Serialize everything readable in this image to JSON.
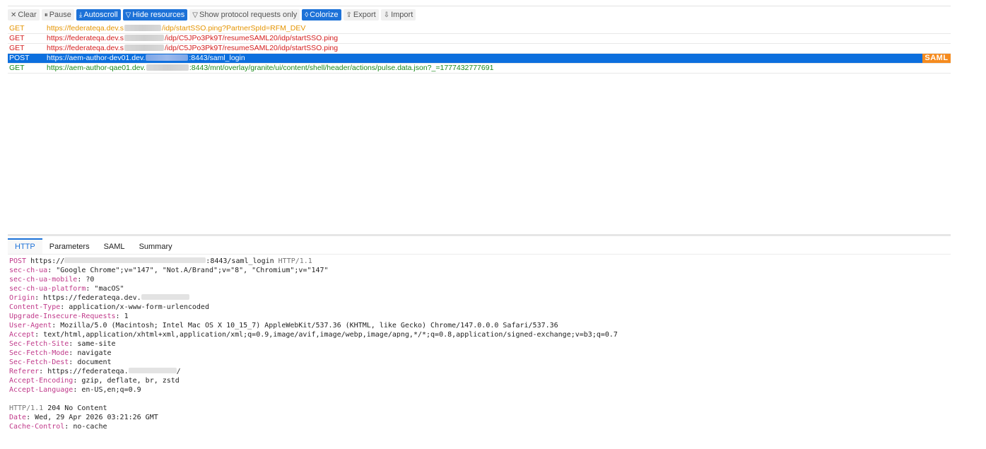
{
  "toolbar": {
    "clear": {
      "icon": "✕",
      "label": "Clear"
    },
    "pause": {
      "icon": "⏸",
      "label": "Pause"
    },
    "autoscroll": {
      "icon": "⤓",
      "label": "Autoscroll"
    },
    "hide_resources": {
      "icon": "▽",
      "label": "Hide resources"
    },
    "protocol_only": {
      "icon": "▽",
      "label": "Show protocol requests only"
    },
    "colorize": {
      "icon": "◊",
      "label": "Colorize"
    },
    "export": {
      "icon": "⇪",
      "label": "Export"
    },
    "import": {
      "icon": "⇩",
      "label": "Import"
    }
  },
  "requests": [
    {
      "method": "GET",
      "url_a": "https://federateqa.dev.s",
      "url_b": "/idp/startSSO.ping?PartnerSpId=RFM_DEV",
      "color": "#e59400"
    },
    {
      "method": "GET",
      "url_a": "https://federateqa.dev.s",
      "url_b": "/idp/C5JPo3Pk9T/resumeSAML20/idp/startSSO.ping",
      "color": "#d41e1e"
    },
    {
      "method": "GET",
      "url_a": "https://federateqa.dev.s",
      "url_b": "/idp/C5JPo3Pk9T/resumeSAML20/idp/startSSO.ping",
      "color": "#d41e1e"
    },
    {
      "method": "POST",
      "url_a": "https://aem-author-dev01.dev.",
      "url_b": ":8443/saml_login",
      "color": "#ffffff",
      "badge": "SAML"
    },
    {
      "method": "GET",
      "url_a": "https://aem-author-qae01.dev.",
      "url_b": ":8443/mnt/overlay/granite/ui/content/shell/header/actions/pulse.data.json?_=1777432777691",
      "color": "#1a8a1a"
    }
  ],
  "tabs": [
    "HTTP",
    "Parameters",
    "SAML",
    "Summary"
  ],
  "request_line": {
    "method": "POST",
    "url_a": "https://",
    "url_b": ":8443/saml_login",
    "proto": "HTTP/1.1"
  },
  "request_headers": [
    {
      "k": "sec-ch-ua",
      "v": "\"Google Chrome\";v=\"147\", \"Not.A/Brand\";v=\"8\", \"Chromium\";v=\"147\""
    },
    {
      "k": "sec-ch-ua-mobile",
      "v": "?0"
    },
    {
      "k": "sec-ch-ua-platform",
      "v": "\"macOS\""
    },
    {
      "k": "Origin",
      "v": "https://federateqa.dev."
    },
    {
      "k": "Content-Type",
      "v": "application/x-www-form-urlencoded"
    },
    {
      "k": "Upgrade-Insecure-Requests",
      "v": "1"
    },
    {
      "k": "User-Agent",
      "v": "Mozilla/5.0 (Macintosh; Intel Mac OS X 10_15_7) AppleWebKit/537.36 (KHTML, like Gecko) Chrome/147.0.0.0 Safari/537.36"
    },
    {
      "k": "Accept",
      "v": "text/html,application/xhtml+xml,application/xml;q=0.9,image/avif,image/webp,image/apng,*/*;q=0.8,application/signed-exchange;v=b3;q=0.7"
    },
    {
      "k": "Sec-Fetch-Site",
      "v": "same-site"
    },
    {
      "k": "Sec-Fetch-Mode",
      "v": "navigate"
    },
    {
      "k": "Sec-Fetch-Dest",
      "v": "document"
    },
    {
      "k": "Referer",
      "v": "https://federateqa."
    },
    {
      "k": "Accept-Encoding",
      "v": "gzip, deflate, br, zstd"
    },
    {
      "k": "Accept-Language",
      "v": "en-US,en;q=0.9"
    }
  ],
  "response_line": {
    "proto": "HTTP/1.1",
    "status": "204 No Content"
  },
  "response_headers": [
    {
      "k": "Date",
      "v": "Wed, 29 Apr 2026 03:21:26 GMT"
    },
    {
      "k": "Cache-Control",
      "v": "no-cache"
    }
  ]
}
